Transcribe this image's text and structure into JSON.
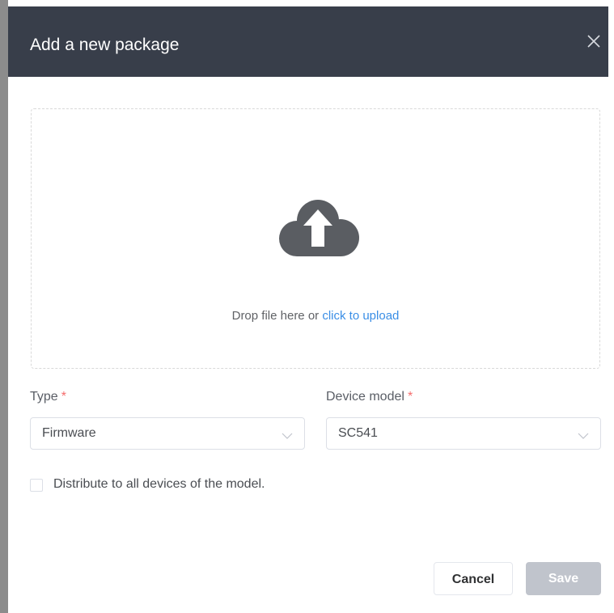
{
  "dialog": {
    "title": "Add a new package",
    "close_icon": "close-icon"
  },
  "upload": {
    "icon": "cloud-upload-icon",
    "text": "Drop file here or ",
    "link": "click to upload"
  },
  "form": {
    "type": {
      "label": "Type",
      "required_mark": "*",
      "value": "Firmware"
    },
    "device_model": {
      "label": "Device model",
      "required_mark": "*",
      "value": "SC541"
    },
    "distribute": {
      "label": "Distribute to all devices of the model.",
      "checked": false
    }
  },
  "footer": {
    "cancel_label": "Cancel",
    "save_label": "Save"
  },
  "colors": {
    "header_bg": "#383e4a",
    "link": "#3a8ee6",
    "required": "#f56c6c",
    "disabled_button": "#c0c4cc"
  }
}
